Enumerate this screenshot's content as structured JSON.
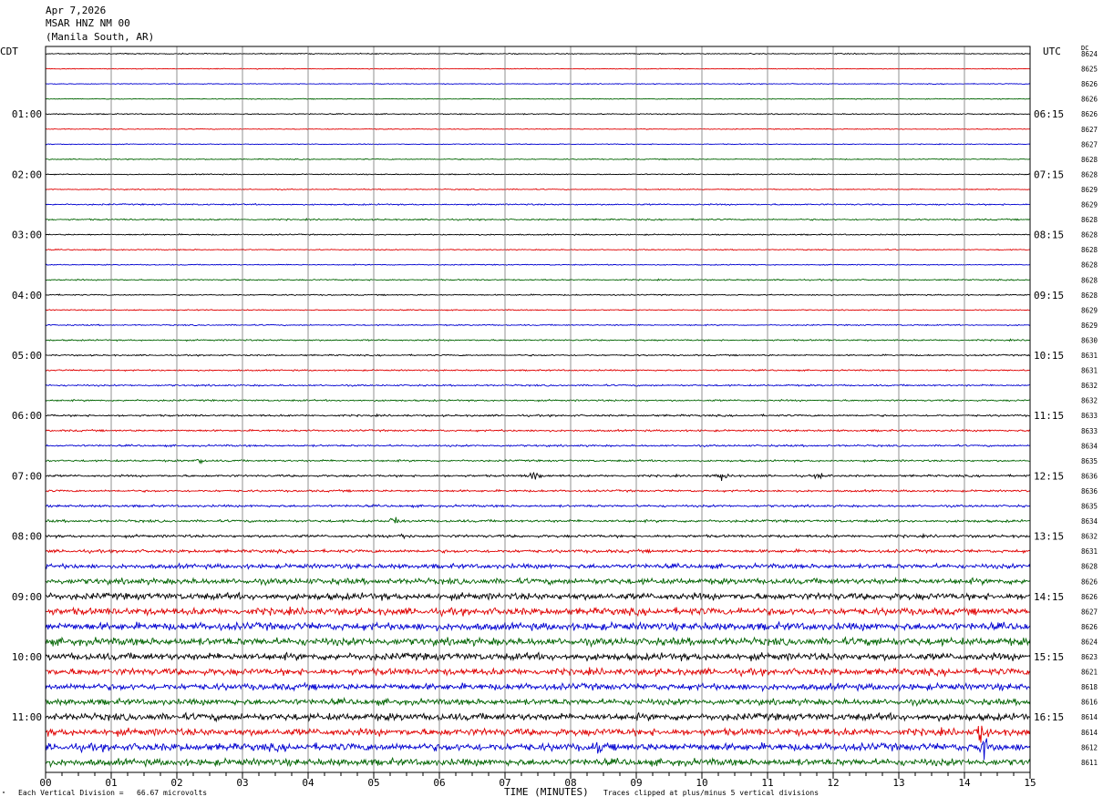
{
  "header": {
    "date": "Apr 7,2026",
    "station": "MSAR HNZ NM 00",
    "location": "(Manila South, AR)"
  },
  "left_timezone": "CDT",
  "right_timezone": "UTC",
  "dc_label": "DC",
  "trace_colors": [
    "#000000",
    "#e00000",
    "#0000d0",
    "#006400"
  ],
  "footer": {
    "scale_text": "Each Vertical Division =   66.67 microvolts",
    "clip_text": "Traces clipped at plus/minus 5 vertical divisions",
    "corner_mark": "\""
  },
  "chart_data": {
    "type": "line",
    "xlabel": "TIME (MINUTES)",
    "x_ticks": [
      "00",
      "01",
      "02",
      "03",
      "04",
      "05",
      "06",
      "07",
      "08",
      "09",
      "10",
      "11",
      "12",
      "13",
      "14",
      "15"
    ],
    "xlim": [
      0,
      15
    ],
    "rows_per_hour": 4,
    "left_hour_labels": [
      "01:00",
      "02:00",
      "03:00",
      "04:00",
      "05:00",
      "06:00",
      "07:00",
      "08:00",
      "09:00",
      "10:00",
      "11:00"
    ],
    "right_hour_labels": [
      "06:15",
      "07:15",
      "08:15",
      "09:15",
      "10:15",
      "11:15",
      "12:15",
      "13:15",
      "14:15",
      "15:15",
      "16:15"
    ],
    "dc_offsets": [
      8624,
      8625,
      8626,
      8626,
      8626,
      8627,
      8627,
      8628,
      8628,
      8629,
      8629,
      8628,
      8628,
      8628,
      8628,
      8628,
      8628,
      8629,
      8629,
      8630,
      8631,
      8631,
      8632,
      8632,
      8633,
      8633,
      8634,
      8635,
      8636,
      8636,
      8635,
      8634,
      8632,
      8631,
      8628,
      8626,
      8626,
      8627,
      8626,
      8624,
      8623,
      8621,
      8618,
      8616,
      8614,
      8614,
      8612,
      8611
    ],
    "noise_level": [
      0.5,
      0.4,
      0.4,
      0.4,
      0.5,
      0.4,
      0.4,
      0.5,
      0.5,
      0.5,
      0.7,
      0.7,
      0.6,
      0.5,
      0.5,
      0.6,
      0.6,
      0.5,
      0.6,
      0.7,
      0.7,
      0.7,
      0.8,
      0.8,
      0.9,
      0.9,
      0.9,
      0.9,
      1.0,
      1.0,
      1.1,
      1.2,
      1.3,
      1.5,
      2.2,
      2.8,
      3.2,
      3.4,
      3.6,
      3.6,
      3.4,
      3.2,
      3.1,
      2.9,
      3.4,
      3.4,
      3.6,
      3.3
    ],
    "events": [
      {
        "row": 27,
        "minute": 2.35,
        "amp": 4
      },
      {
        "row": 28,
        "minute": 7.45,
        "amp": 8
      },
      {
        "row": 28,
        "minute": 10.3,
        "amp": 7
      },
      {
        "row": 28,
        "minute": 11.8,
        "amp": 5
      },
      {
        "row": 31,
        "minute": 5.3,
        "amp": 8
      },
      {
        "row": 32,
        "minute": 5.45,
        "amp": 5
      },
      {
        "row": 37,
        "minute": 10.55,
        "amp": 6
      },
      {
        "row": 39,
        "minute": 12.6,
        "amp": 7
      },
      {
        "row": 45,
        "minute": 14.25,
        "amp": 12
      },
      {
        "row": 46,
        "minute": 14.3,
        "amp": 14
      },
      {
        "row": 46,
        "minute": 8.4,
        "amp": 8
      }
    ]
  }
}
